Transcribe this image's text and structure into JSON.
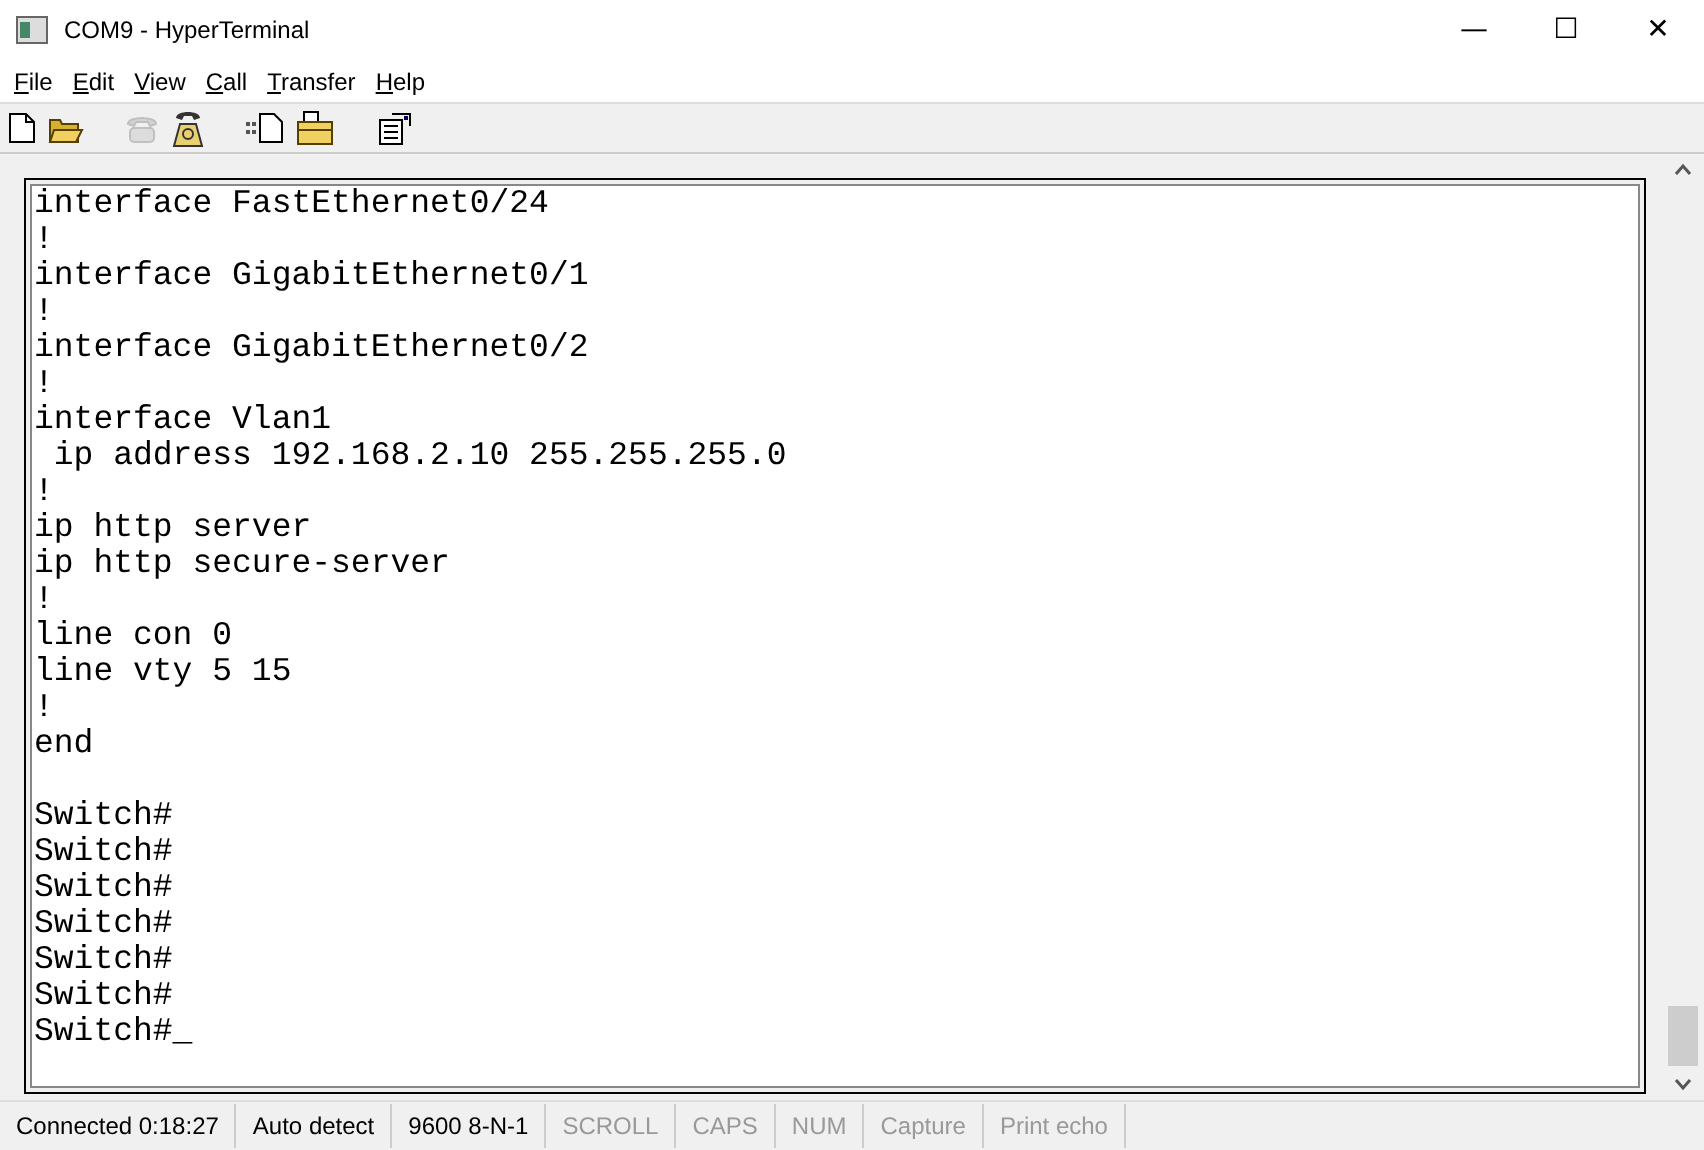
{
  "window": {
    "title": "COM9 - HyperTerminal",
    "controls": [
      "—",
      "☐",
      "✕"
    ]
  },
  "menu": [
    {
      "label": "File"
    },
    {
      "label": "Edit"
    },
    {
      "label": "View"
    },
    {
      "label": "Call"
    },
    {
      "label": "Transfer"
    },
    {
      "label": "Help"
    }
  ],
  "toolbar": [
    {
      "kind": "new",
      "disabled": false
    },
    {
      "kind": "open",
      "disabled": false
    },
    {
      "kind": "gap"
    },
    {
      "kind": "call",
      "disabled": true
    },
    {
      "kind": "disconnect",
      "disabled": false
    },
    {
      "kind": "gap"
    },
    {
      "kind": "send",
      "disabled": false
    },
    {
      "kind": "receive",
      "disabled": false
    },
    {
      "kind": "gap"
    },
    {
      "kind": "properties",
      "disabled": false
    }
  ],
  "terminal": {
    "lines": [
      "interface FastEthernet0/24",
      "!",
      "interface GigabitEthernet0/1",
      "!",
      "interface GigabitEthernet0/2",
      "!",
      "interface Vlan1",
      " ip address 192.168.2.10 255.255.255.0",
      "!",
      "ip http server",
      "ip http secure-server",
      "!",
      "line con 0",
      "line vty 5 15",
      "!",
      "end"
    ],
    "prompt_lines": [
      "Switch#",
      "Switch#",
      "Switch#",
      "Switch#",
      "Switch#",
      "Switch#",
      "Switch#_"
    ]
  },
  "status_bar": [
    {
      "text": "Connected 0:18:27",
      "disabled": false
    },
    {
      "text": "Auto detect",
      "disabled": false
    },
    {
      "text": "9600 8-N-1",
      "disabled": false
    },
    {
      "text": "SCROLL",
      "disabled": true
    },
    {
      "text": "CAPS",
      "disabled": true
    },
    {
      "text": "NUM",
      "disabled": true
    },
    {
      "text": "Capture",
      "disabled": true
    },
    {
      "text": "Print echo",
      "disabled": true
    }
  ]
}
